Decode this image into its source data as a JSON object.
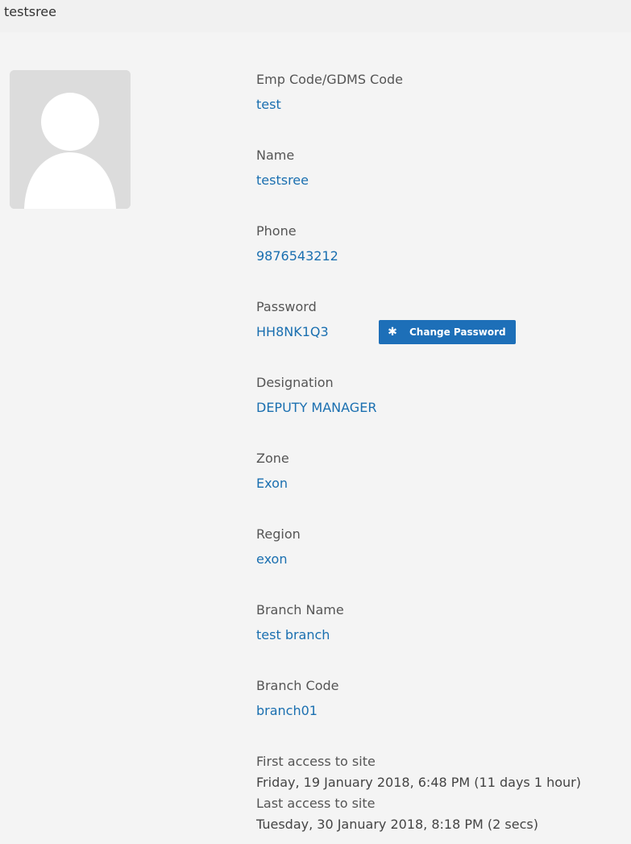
{
  "header": {
    "title": "testsree"
  },
  "avatar": {
    "icon": "user-placeholder-icon"
  },
  "fields": [
    {
      "label": "Emp Code/GDMS Code",
      "value": "test"
    },
    {
      "label": "Name",
      "value": "testsree"
    },
    {
      "label": "Phone",
      "value": "9876543212"
    },
    {
      "label": "Password",
      "value": "HH8NK1Q3"
    },
    {
      "label": "Designation",
      "value": "DEPUTY MANAGER"
    },
    {
      "label": "Zone",
      "value": "Exon"
    },
    {
      "label": "Region",
      "value": "exon"
    },
    {
      "label": "Branch Name",
      "value": "test branch"
    },
    {
      "label": "Branch Code",
      "value": "branch01"
    }
  ],
  "change_password": {
    "label": "Change Password",
    "icon": "asterisk-icon",
    "color": "#1d6fb8"
  },
  "access": {
    "first_label": "First access to site",
    "first_value": "Friday, 19 January 2018, 6:48 PM  (11 days 1 hour)",
    "last_label": "Last access to site",
    "last_value": "Tuesday, 30 January 2018, 8:18 PM  (2 secs)"
  },
  "colors": {
    "value_text": "#1a6fb0",
    "label_text": "#555555",
    "panel_bg": "#f4f4f4"
  }
}
